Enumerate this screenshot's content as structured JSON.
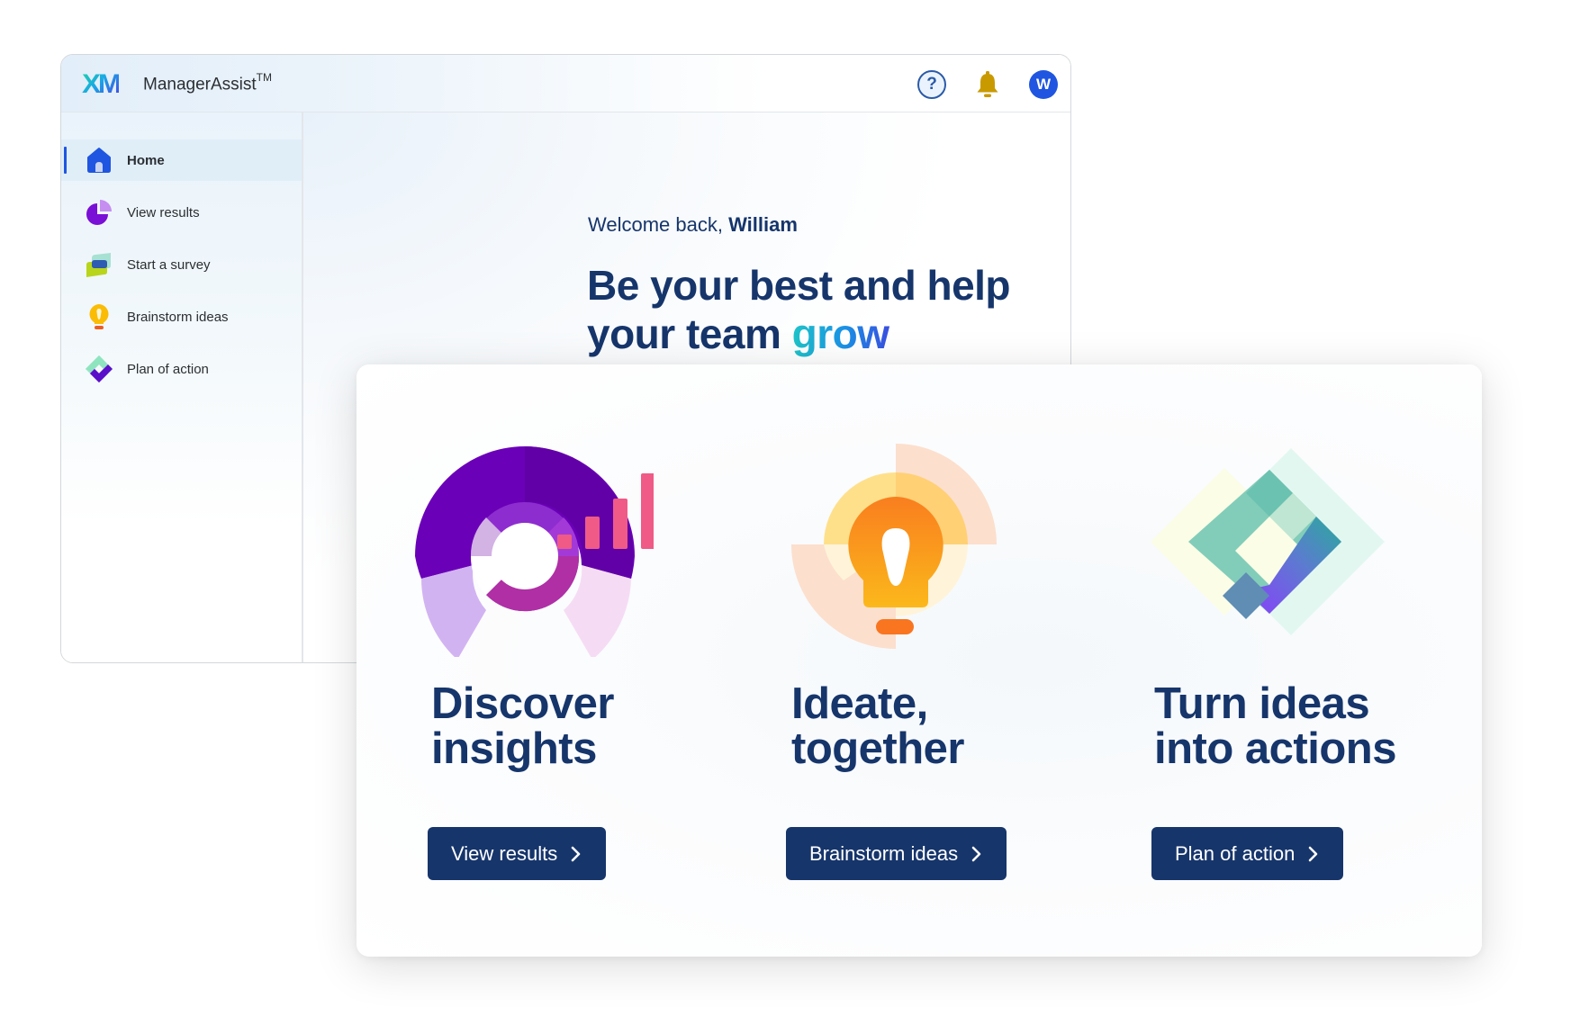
{
  "window": {
    "logo": "XM",
    "app_name": "ManagerAssist",
    "app_trademark": "TM",
    "header_icons": {
      "help": "help-circle-icon",
      "notifications": "bell-icon",
      "avatar_initial": "W"
    }
  },
  "sidebar": {
    "items": [
      {
        "label": "Home",
        "icon": "home-icon",
        "active": true
      },
      {
        "label": "View results",
        "icon": "pie-chart-icon",
        "active": false
      },
      {
        "label": "Start a survey",
        "icon": "chat-bubbles-icon",
        "active": false
      },
      {
        "label": "Brainstorm ideas",
        "icon": "lightbulb-icon",
        "active": false
      },
      {
        "label": "Plan of action",
        "icon": "diamond-check-icon",
        "active": false
      }
    ]
  },
  "main": {
    "welcome_prefix": "Welcome back, ",
    "user_name": "William",
    "hero_line1": "Be your best and help",
    "hero_line2_prefix": "your team ",
    "hero_highlight": "grow"
  },
  "features": [
    {
      "title": "Discover\ninsights",
      "button": "View results",
      "illustration": "donut-bar-chart-illustration"
    },
    {
      "title": "Ideate,\ntogether",
      "button": "Brainstorm ideas",
      "illustration": "lightbulb-illustration"
    },
    {
      "title": "Turn ideas\ninto actions",
      "button": "Plan of action",
      "illustration": "diamond-illustration"
    }
  ],
  "colors": {
    "navy": "#16356b",
    "accent_blue": "#1f55e0",
    "bell": "#c99a00",
    "bar_pink": "#ef5b86"
  }
}
